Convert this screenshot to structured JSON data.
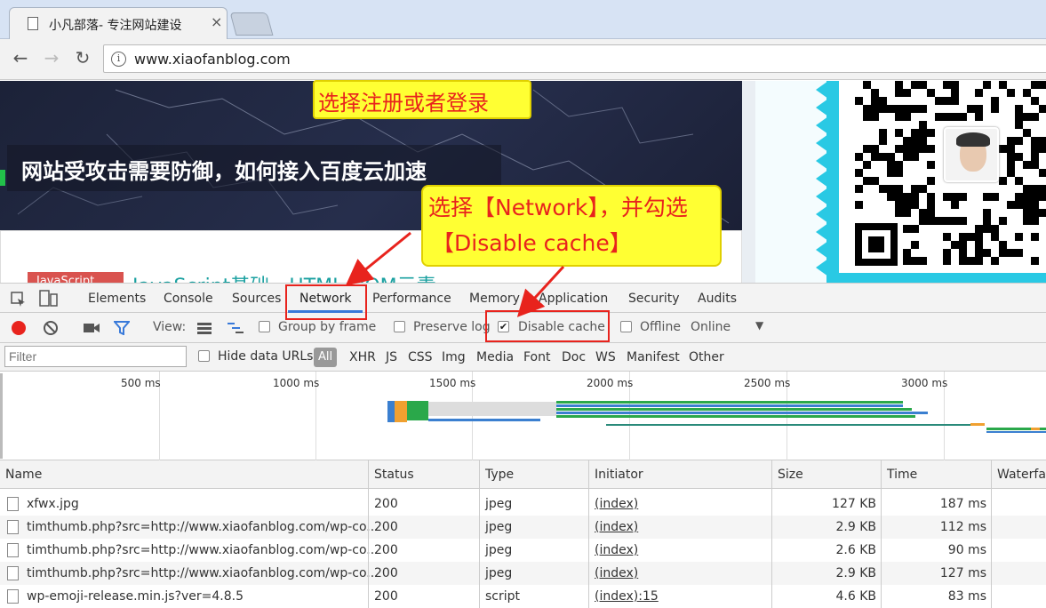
{
  "browser": {
    "tab_title": "小凡部落- 专注网站建设",
    "tab_close": "×",
    "url": "www.xiaofanblog.com",
    "nav": {
      "back": "←",
      "forward": "→",
      "reload": "↻",
      "info": "i"
    }
  },
  "page": {
    "headline": "网站受攻击需要防御，如何接入百度云加速",
    "tag": "JavaScript",
    "article_title": "JavaScript基础 - HTML DOM元素"
  },
  "callouts": {
    "register": "选择注册或者登录",
    "network_line1": "选择【Network】，并勾选",
    "network_line2": "【Disable cache】",
    "color": "#e8231d"
  },
  "devtools": {
    "tabs": [
      "Elements",
      "Console",
      "Sources",
      "Network",
      "Performance",
      "Memory",
      "Application",
      "Security",
      "Audits"
    ],
    "active_tab": "Network",
    "controls": {
      "view_label": "View:",
      "group_by_frame": "Group by frame",
      "preserve_log": "Preserve log",
      "disable_cache": "Disable cache",
      "disable_cache_checked": true,
      "offline": "Offline",
      "throttle": "Online"
    },
    "filter": {
      "placeholder": "Filter",
      "hide_data_urls": "Hide data URLs",
      "types": [
        "All",
        "XHR",
        "JS",
        "CSS",
        "Img",
        "Media",
        "Font",
        "Doc",
        "WS",
        "Manifest",
        "Other"
      ]
    },
    "timeline_ticks": [
      "500 ms",
      "1000 ms",
      "1500 ms",
      "2000 ms",
      "2500 ms",
      "3000 ms"
    ],
    "columns": [
      "Name",
      "Status",
      "Type",
      "Initiator",
      "Size",
      "Time",
      "Waterfall"
    ],
    "rows": [
      {
        "name": "xfwx.jpg",
        "status": "200",
        "type": "jpeg",
        "initiator": "(index)",
        "size": "127 KB",
        "time": "187 ms"
      },
      {
        "name": "timthumb.php?src=http://www.xiaofanblog.com/wp-co...",
        "status": "200",
        "type": "jpeg",
        "initiator": "(index)",
        "size": "2.9 KB",
        "time": "112 ms"
      },
      {
        "name": "timthumb.php?src=http://www.xiaofanblog.com/wp-co...",
        "status": "200",
        "type": "jpeg",
        "initiator": "(index)",
        "size": "2.6 KB",
        "time": "90 ms"
      },
      {
        "name": "timthumb.php?src=http://www.xiaofanblog.com/wp-co...",
        "status": "200",
        "type": "jpeg",
        "initiator": "(index)",
        "size": "2.9 KB",
        "time": "127 ms"
      },
      {
        "name": "wp-emoji-release.min.js?ver=4.8.5",
        "status": "200",
        "type": "script",
        "initiator": "(index):15",
        "size": "4.6 KB",
        "time": "83 ms"
      }
    ]
  }
}
